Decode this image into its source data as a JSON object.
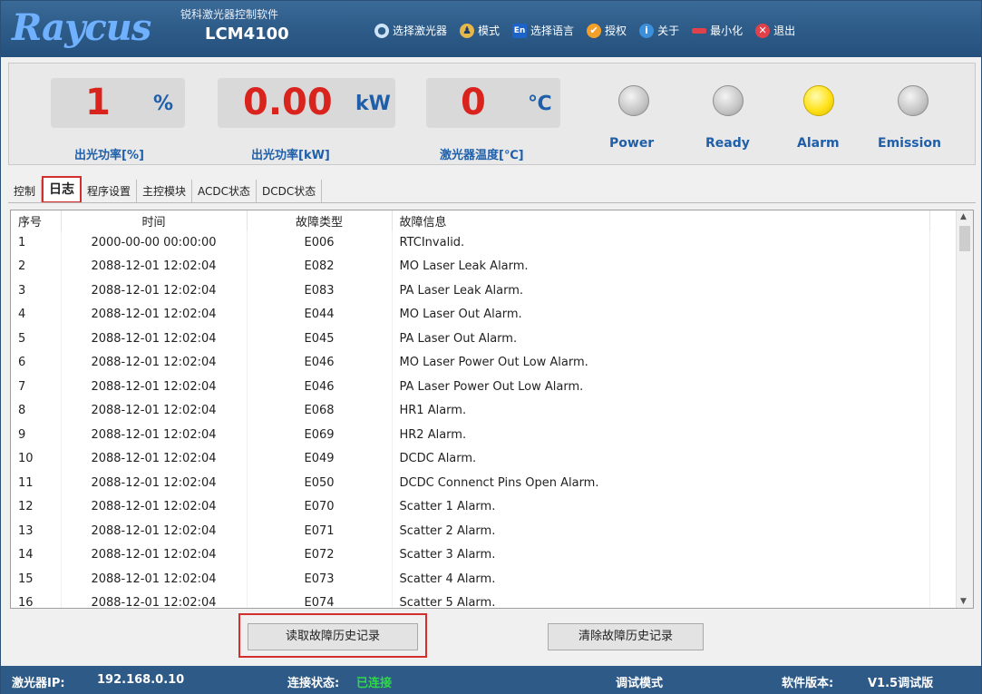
{
  "app": {
    "brand": "Raycus",
    "subtitle": "锐科激光器控制软件",
    "model": "LCM4100"
  },
  "menu": [
    {
      "id": "select-laser",
      "label": "选择激光器",
      "icon": "laser-icon"
    },
    {
      "id": "mode",
      "label": "模式",
      "icon": "users-icon"
    },
    {
      "id": "language",
      "label": "选择语言",
      "icon": "language-en-icon"
    },
    {
      "id": "authorize",
      "label": "授权",
      "icon": "shield-icon"
    },
    {
      "id": "about",
      "label": "关于",
      "icon": "info-icon"
    },
    {
      "id": "minimize",
      "label": "最小化",
      "icon": "minimize-icon"
    },
    {
      "id": "exit",
      "label": "退出",
      "icon": "close-icon"
    }
  ],
  "readouts": {
    "power_percent": {
      "value": "1",
      "unit": "%",
      "label": "出光功率[%]"
    },
    "power_kw": {
      "value": "0.00",
      "unit": "kW",
      "label": "出光功率[kW]"
    },
    "temperature": {
      "value": "0",
      "unit": "℃",
      "label": "激光器温度[℃]"
    }
  },
  "indicators": [
    {
      "label": "Power",
      "on": false
    },
    {
      "label": "Ready",
      "on": false
    },
    {
      "label": "Alarm",
      "on": true
    },
    {
      "label": "Emission",
      "on": false
    }
  ],
  "tabs": [
    "控制",
    "日志",
    "程序设置",
    "主控模块",
    "ACDC状态",
    "DCDC状态"
  ],
  "active_tab": "日志",
  "log": {
    "columns": [
      "序号",
      "时间",
      "故障类型",
      "故障信息"
    ],
    "rows": [
      [
        "1",
        "2000-00-00 00:00:00",
        "E006",
        "RTCInvalid."
      ],
      [
        "2",
        "2088-12-01 12:02:04",
        "E082",
        "MO Laser Leak Alarm."
      ],
      [
        "3",
        "2088-12-01 12:02:04",
        "E083",
        "PA Laser Leak Alarm."
      ],
      [
        "4",
        "2088-12-01 12:02:04",
        "E044",
        "MO Laser Out Alarm."
      ],
      [
        "5",
        "2088-12-01 12:02:04",
        "E045",
        "PA Laser Out Alarm."
      ],
      [
        "6",
        "2088-12-01 12:02:04",
        "E046",
        "MO Laser Power Out Low Alarm."
      ],
      [
        "7",
        "2088-12-01 12:02:04",
        "E046",
        "PA Laser Power Out Low Alarm."
      ],
      [
        "8",
        "2088-12-01 12:02:04",
        "E068",
        "HR1 Alarm."
      ],
      [
        "9",
        "2088-12-01 12:02:04",
        "E069",
        "HR2 Alarm."
      ],
      [
        "10",
        "2088-12-01 12:02:04",
        "E049",
        "DCDC Alarm."
      ],
      [
        "11",
        "2088-12-01 12:02:04",
        "E050",
        "DCDC Connenct Pins Open Alarm."
      ],
      [
        "12",
        "2088-12-01 12:02:04",
        "E070",
        "Scatter 1 Alarm."
      ],
      [
        "13",
        "2088-12-01 12:02:04",
        "E071",
        "Scatter 2 Alarm."
      ],
      [
        "14",
        "2088-12-01 12:02:04",
        "E072",
        "Scatter 3 Alarm."
      ],
      [
        "15",
        "2088-12-01 12:02:04",
        "E073",
        "Scatter 4 Alarm."
      ],
      [
        "16",
        "2088-12-01 12:02:04",
        "E074",
        "Scatter 5 Alarm."
      ]
    ]
  },
  "buttons": {
    "read_history": "读取故障历史记录",
    "clear_history": "清除故障历史记录"
  },
  "statusbar": {
    "ip_label": "激光器IP:",
    "ip_value": "192.168.0.10",
    "conn_label": "连接状态:",
    "conn_value": "已连接",
    "mode": "调试模式",
    "version_label": "软件版本:",
    "version_value": "V1.5调试版"
  },
  "colors": {
    "title_bg": "#2f5d8a",
    "readout_value": "#d9241e",
    "label_blue": "#1f5faa",
    "alarm_on": "#ffe21a",
    "highlight": "#d32f2f",
    "connected": "#31d84a"
  }
}
